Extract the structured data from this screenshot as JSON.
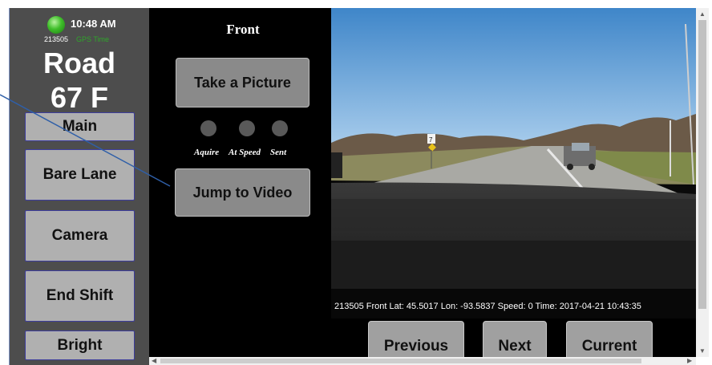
{
  "status": {
    "time": "10:48 AM",
    "unit_id": "213505",
    "gps_text": "GPS Time",
    "road": "Road",
    "temperature": "67 F",
    "indicator_color": "#3fbf2a"
  },
  "sidebar": {
    "buttons": [
      {
        "label": "Main"
      },
      {
        "label": "Bare Lane"
      },
      {
        "label": "Camera"
      },
      {
        "label": "End Shift"
      },
      {
        "label": "Bright"
      }
    ]
  },
  "camera_panel": {
    "title": "Front",
    "take_picture": "Take a Picture",
    "jump_to_video": "Jump to Video",
    "indicators": [
      {
        "label": "Aquire"
      },
      {
        "label": "At Speed"
      },
      {
        "label": "Sent"
      }
    ]
  },
  "view": {
    "caption": "213505 Front Lat: 45.5017 Lon: -93.5837 Speed: 0 Time: 2017-04-21 10:43:35",
    "sign_number": "7"
  },
  "navigation": {
    "previous": "Previous",
    "next": "Next",
    "current": "Current"
  },
  "icons": {
    "scroll_up": "scroll-up-arrow",
    "scroll_down": "scroll-down-arrow",
    "scroll_left": "scroll-left-arrow",
    "scroll_right": "scroll-right-arrow"
  }
}
